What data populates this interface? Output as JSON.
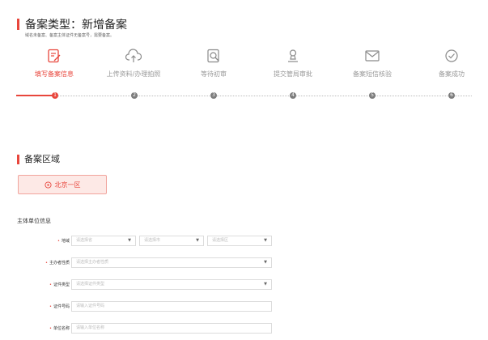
{
  "header": {
    "title": "备案类型：新增备案",
    "subtitle": "域名未备案、备案主体证件无备案号，需要备案。"
  },
  "steps": [
    {
      "label": "填写备案信息",
      "number": "1",
      "icon": "edit-document-icon",
      "active": true
    },
    {
      "label": "上传资料/办理拍照",
      "number": "2",
      "icon": "cloud-upload-icon",
      "active": false
    },
    {
      "label": "等待初审",
      "number": "3",
      "icon": "search-review-icon",
      "active": false
    },
    {
      "label": "提交管局审批",
      "number": "4",
      "icon": "user-stamp-icon",
      "active": false
    },
    {
      "label": "备案短信核验",
      "number": "5",
      "icon": "envelope-icon",
      "active": false
    },
    {
      "label": "备案成功",
      "number": "6",
      "icon": "check-circle-icon",
      "active": false
    }
  ],
  "region_section": {
    "title": "备案区域",
    "selected_region": "北京一区"
  },
  "entity_section": {
    "title": "主体单位信息",
    "rows": [
      {
        "label": "地域",
        "required": true,
        "fields": [
          {
            "placeholder": "请选择省",
            "type": "select"
          },
          {
            "placeholder": "请选择市",
            "type": "select"
          },
          {
            "placeholder": "请选择区",
            "type": "select"
          }
        ]
      },
      {
        "label": "主办者性质",
        "required": true,
        "fields": [
          {
            "placeholder": "请选择主办者性质",
            "type": "select"
          }
        ]
      },
      {
        "label": "证件类型",
        "required": true,
        "fields": [
          {
            "placeholder": "请选择证件类型",
            "type": "select"
          }
        ]
      },
      {
        "label": "证件号码",
        "required": true,
        "fields": [
          {
            "placeholder": "请输入证件号码",
            "type": "text"
          }
        ]
      },
      {
        "label": "单位名称",
        "required": true,
        "fields": [
          {
            "placeholder": "请输入单位名称",
            "type": "text"
          }
        ]
      }
    ]
  },
  "colors": {
    "accent": "#e8463c",
    "inactive": "#7c7c7c",
    "region_bg": "#fde9e6"
  }
}
